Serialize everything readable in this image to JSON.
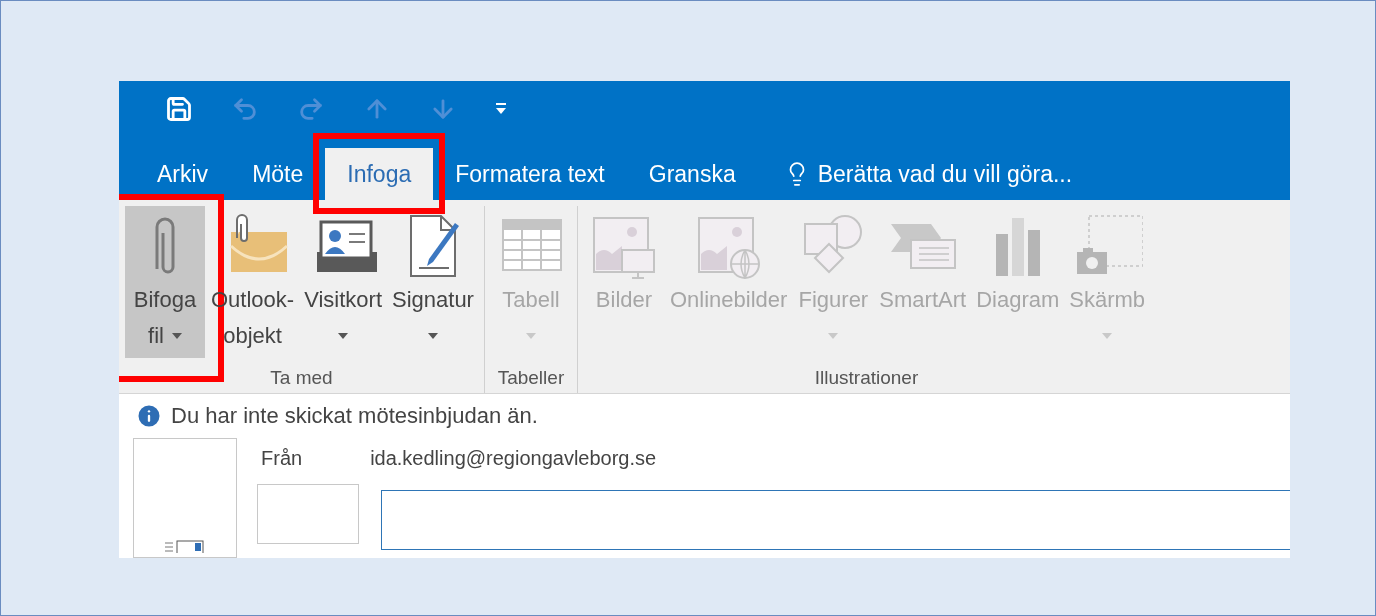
{
  "quick_access": [
    {
      "kind": "save",
      "disabled": false
    },
    {
      "kind": "undo",
      "disabled": true
    },
    {
      "kind": "redo",
      "disabled": true
    },
    {
      "kind": "up",
      "disabled": true
    },
    {
      "kind": "down",
      "disabled": true
    },
    {
      "kind": "customize",
      "disabled": false
    }
  ],
  "tabs": [
    {
      "label": "Arkiv",
      "selected": false,
      "highlighted": false
    },
    {
      "label": "Möte",
      "selected": false,
      "highlighted": false
    },
    {
      "label": "Infoga",
      "selected": true,
      "highlighted": true
    },
    {
      "label": "Formatera text",
      "selected": false,
      "highlighted": false
    },
    {
      "label": "Granska",
      "selected": false,
      "highlighted": false
    }
  ],
  "tell_me": {
    "placeholder": "Berätta vad du vill göra..."
  },
  "ribbon_groups": [
    {
      "label": "Ta med",
      "buttons": [
        {
          "kind": "attach",
          "lines": [
            "Bifoga",
            "fil"
          ],
          "dropdown": true,
          "disabled": false,
          "pressed": true,
          "highlighted": true
        },
        {
          "kind": "item",
          "lines": [
            "Outlook-",
            "objekt"
          ],
          "dropdown": false,
          "disabled": false,
          "pressed": false,
          "highlighted": false
        },
        {
          "kind": "card",
          "lines": [
            "Visitkort"
          ],
          "dropdown": true,
          "disabled": false,
          "pressed": false,
          "highlighted": false
        },
        {
          "kind": "signature",
          "lines": [
            "Signatur"
          ],
          "dropdown": true,
          "disabled": false,
          "pressed": false,
          "highlighted": false
        }
      ]
    },
    {
      "label": "Tabeller",
      "buttons": [
        {
          "kind": "table",
          "lines": [
            "Tabell"
          ],
          "dropdown": true,
          "disabled": true,
          "pressed": false,
          "highlighted": false
        }
      ]
    },
    {
      "label": "Illustrationer",
      "buttons": [
        {
          "kind": "pictures",
          "lines": [
            "Bilder"
          ],
          "dropdown": false,
          "disabled": true,
          "pressed": false,
          "highlighted": false
        },
        {
          "kind": "online",
          "lines": [
            "Onlinebilder"
          ],
          "dropdown": false,
          "disabled": true,
          "pressed": false,
          "highlighted": false
        },
        {
          "kind": "shapes",
          "lines": [
            "Figurer"
          ],
          "dropdown": true,
          "disabled": true,
          "pressed": false,
          "highlighted": false
        },
        {
          "kind": "smartart",
          "lines": [
            "SmartArt"
          ],
          "dropdown": false,
          "disabled": true,
          "pressed": false,
          "highlighted": false
        },
        {
          "kind": "chart",
          "lines": [
            "Diagram"
          ],
          "dropdown": false,
          "disabled": true,
          "pressed": false,
          "highlighted": false
        },
        {
          "kind": "screenshot",
          "lines": [
            "Skärmb"
          ],
          "dropdown": true,
          "disabled": true,
          "pressed": false,
          "highlighted": false
        }
      ]
    }
  ],
  "info_bar": {
    "text": "Du har inte skickat mötesinbjudan än."
  },
  "from": {
    "label": "Från",
    "value": "ida.kedling@regiongavleborg.se"
  }
}
